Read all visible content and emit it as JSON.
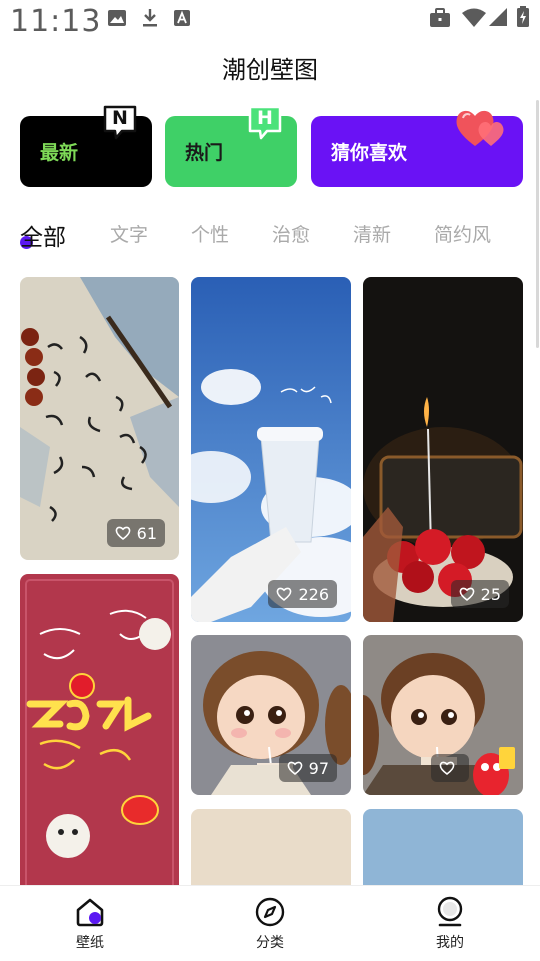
{
  "status_bar": {
    "time": "11:13"
  },
  "header": {
    "title": "潮创壁图"
  },
  "feature_cards": [
    {
      "label": "最新",
      "badge": "N"
    },
    {
      "label": "热门",
      "badge": "H"
    },
    {
      "label": "猜你喜欢"
    }
  ],
  "tabs": [
    "全部",
    "文字",
    "个性",
    "治愈",
    "清新",
    "简约风"
  ],
  "wallpapers": [
    {
      "likes": "61"
    },
    {
      "likes": "226"
    },
    {
      "likes": "25"
    },
    {
      "likes": "97"
    },
    {
      "likes": ""
    }
  ],
  "bottom_nav": [
    {
      "label": "壁纸"
    },
    {
      "label": "分类"
    },
    {
      "label": "我的"
    }
  ],
  "colors": {
    "accent": "#6a12f5",
    "hot_green": "#3fd067",
    "new_green_text": "#7ed957"
  }
}
